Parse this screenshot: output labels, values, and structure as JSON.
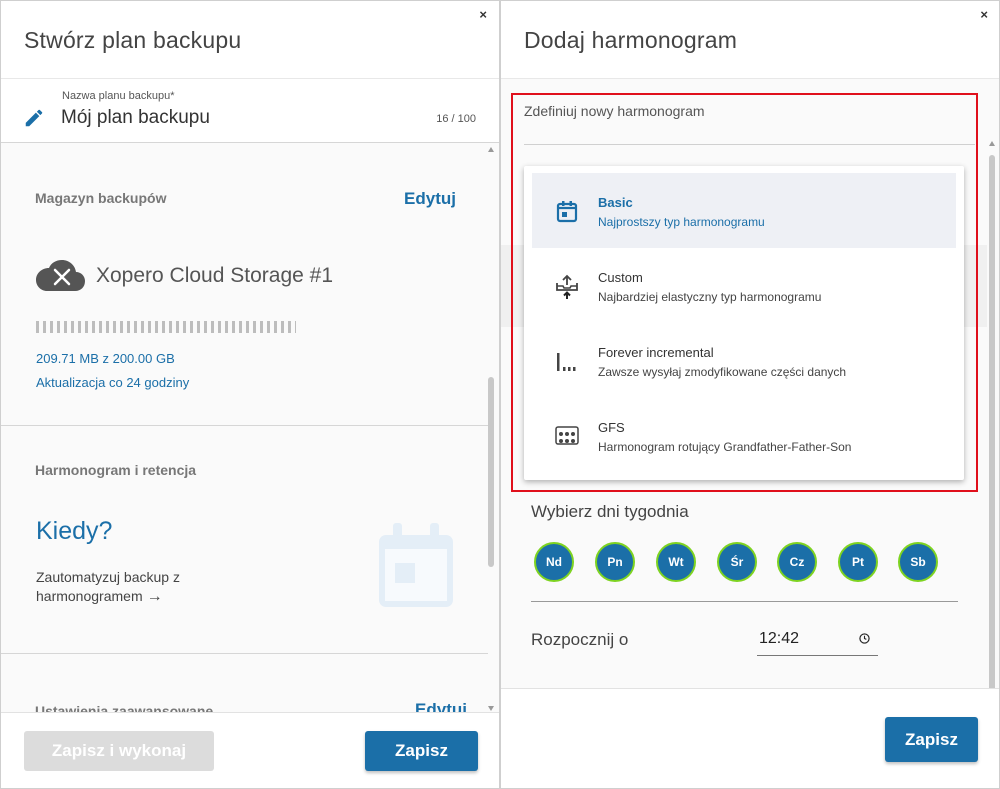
{
  "left": {
    "title": "Stwórz plan backupu",
    "close_label": "×",
    "plan_name": {
      "label": "Nazwa planu backupu*",
      "value": "Mój plan backupu",
      "counter": "16 / 100"
    },
    "storage": {
      "title": "Magazyn backupów",
      "edit_label": "Edytuj",
      "name": "Xopero Cloud Storage #1",
      "usage": "209.71 MB z 200.00 GB",
      "update": "Aktualizacja co 24 godziny"
    },
    "schedule": {
      "title": "Harmonogram i retencja",
      "when": "Kiedy?",
      "automate_text": "Zautomatyzuj backup z harmonogramem",
      "arrow": "→"
    },
    "advanced": {
      "title": "Ustawienia zaawansowane",
      "edit_label": "Edytuj"
    },
    "buttons": {
      "save_run": "Zapisz i wykonaj",
      "save": "Zapisz"
    }
  },
  "right": {
    "title": "Dodaj harmonogram",
    "close_label": "×",
    "define_label": "Zdefiniuj nowy harmonogram",
    "schedule_types": [
      {
        "title": "Basic",
        "desc": "Najprostszy typ harmonogramu",
        "icon": "calendar-icon",
        "selected": true
      },
      {
        "title": "Custom",
        "desc": "Najbardziej elastyczny typ harmonogramu",
        "icon": "upload-tray-icon",
        "selected": false
      },
      {
        "title": "Forever incremental",
        "desc": "Zawsze wysyłaj zmodyfikowane części danych",
        "icon": "incremental-icon",
        "selected": false
      },
      {
        "title": "GFS",
        "desc": "Harmonogram rotujący Grandfather-Father-Son",
        "icon": "gfs-icon",
        "selected": false
      }
    ],
    "weekdays_label": "Wybierz dni tygodnia",
    "weekdays": [
      "Nd",
      "Pn",
      "Wt",
      "Śr",
      "Cz",
      "Pt",
      "Sb"
    ],
    "start_label": "Rozpocznij o",
    "start_time": "12:42",
    "save_label": "Zapisz"
  },
  "colors": {
    "accent": "#1b6fa8",
    "highlight_border": "#e0101c",
    "day_border": "#7ed321"
  }
}
